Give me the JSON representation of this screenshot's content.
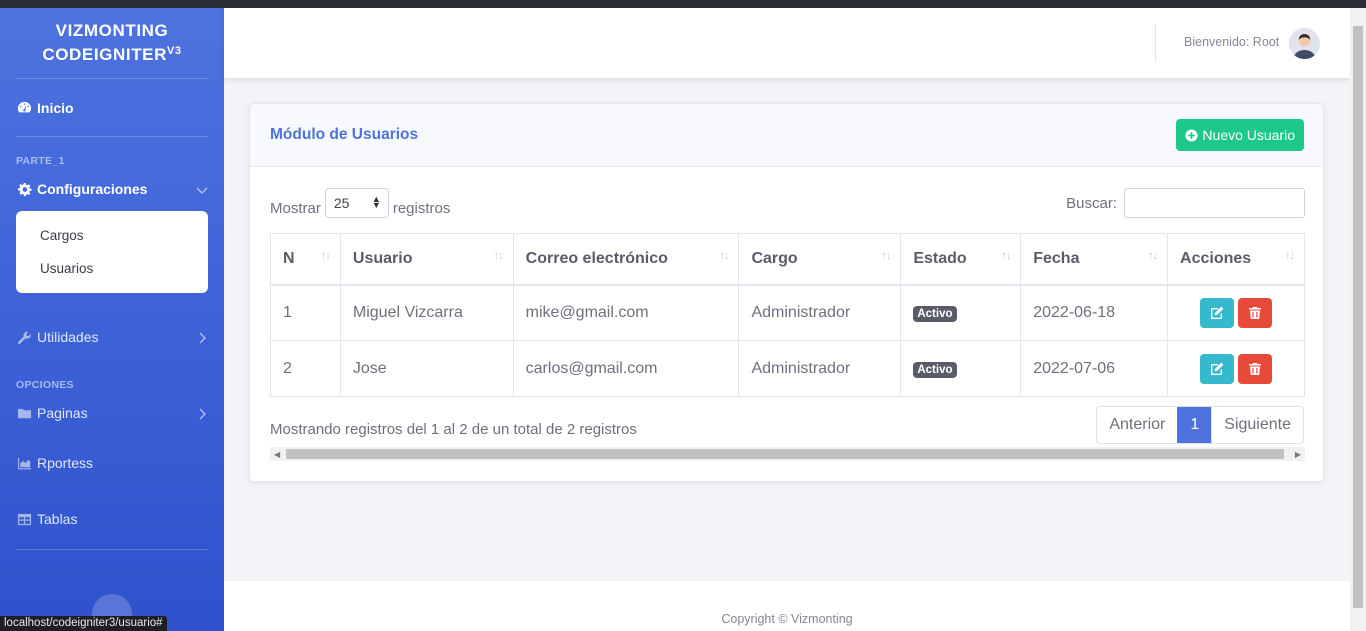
{
  "brand": {
    "line1": "VIZMONTING",
    "line2": "CODEIGNITER",
    "sup": "V3"
  },
  "sidebar": {
    "inicio": "Inicio",
    "heading1": "PARTE_1",
    "configuraciones": "Configuraciones",
    "sub_items": [
      "Cargos",
      "Usuarios"
    ],
    "utilidades": "Utilidades",
    "heading2": "OPCIONES",
    "paginas": "Paginas",
    "reportes": "Rportess",
    "tablas": "Tablas"
  },
  "topbar": {
    "welcome": "Bienvenido: Root"
  },
  "card": {
    "title": "Módulo de Usuarios",
    "new_button": "Nuevo Usuario"
  },
  "controls": {
    "show_label": "Mostrar",
    "length_value": "25",
    "records_label": "registros",
    "search_label": "Buscar:"
  },
  "table": {
    "headers": [
      "N",
      "Usuario",
      "Correo electrónico",
      "Cargo",
      "Estado",
      "Fecha",
      "Acciones"
    ],
    "rows": [
      {
        "n": "1",
        "usuario": "Miguel Vizcarra",
        "correo": "mike@gmail.com",
        "cargo": "Administrador",
        "estado": "Activo",
        "fecha": "2022-06-18"
      },
      {
        "n": "2",
        "usuario": "Jose",
        "correo": "carlos@gmail.com",
        "cargo": "Administrador",
        "estado": "Activo",
        "fecha": "2022-07-06"
      }
    ]
  },
  "pagination": {
    "info": "Mostrando registros del 1 al 2 de un total de 2 registros",
    "prev": "Anterior",
    "current": "1",
    "next": "Siguiente"
  },
  "footer": {
    "copyright": "Copyright © Vizmonting"
  },
  "statusbar": {
    "url": "localhost/codeigniter3/usuario#"
  },
  "colors": {
    "primary": "#4e73df",
    "success": "#1cc88a",
    "info": "#36b9cc",
    "danger": "#e74a3b",
    "badge": "#5a5c69"
  }
}
